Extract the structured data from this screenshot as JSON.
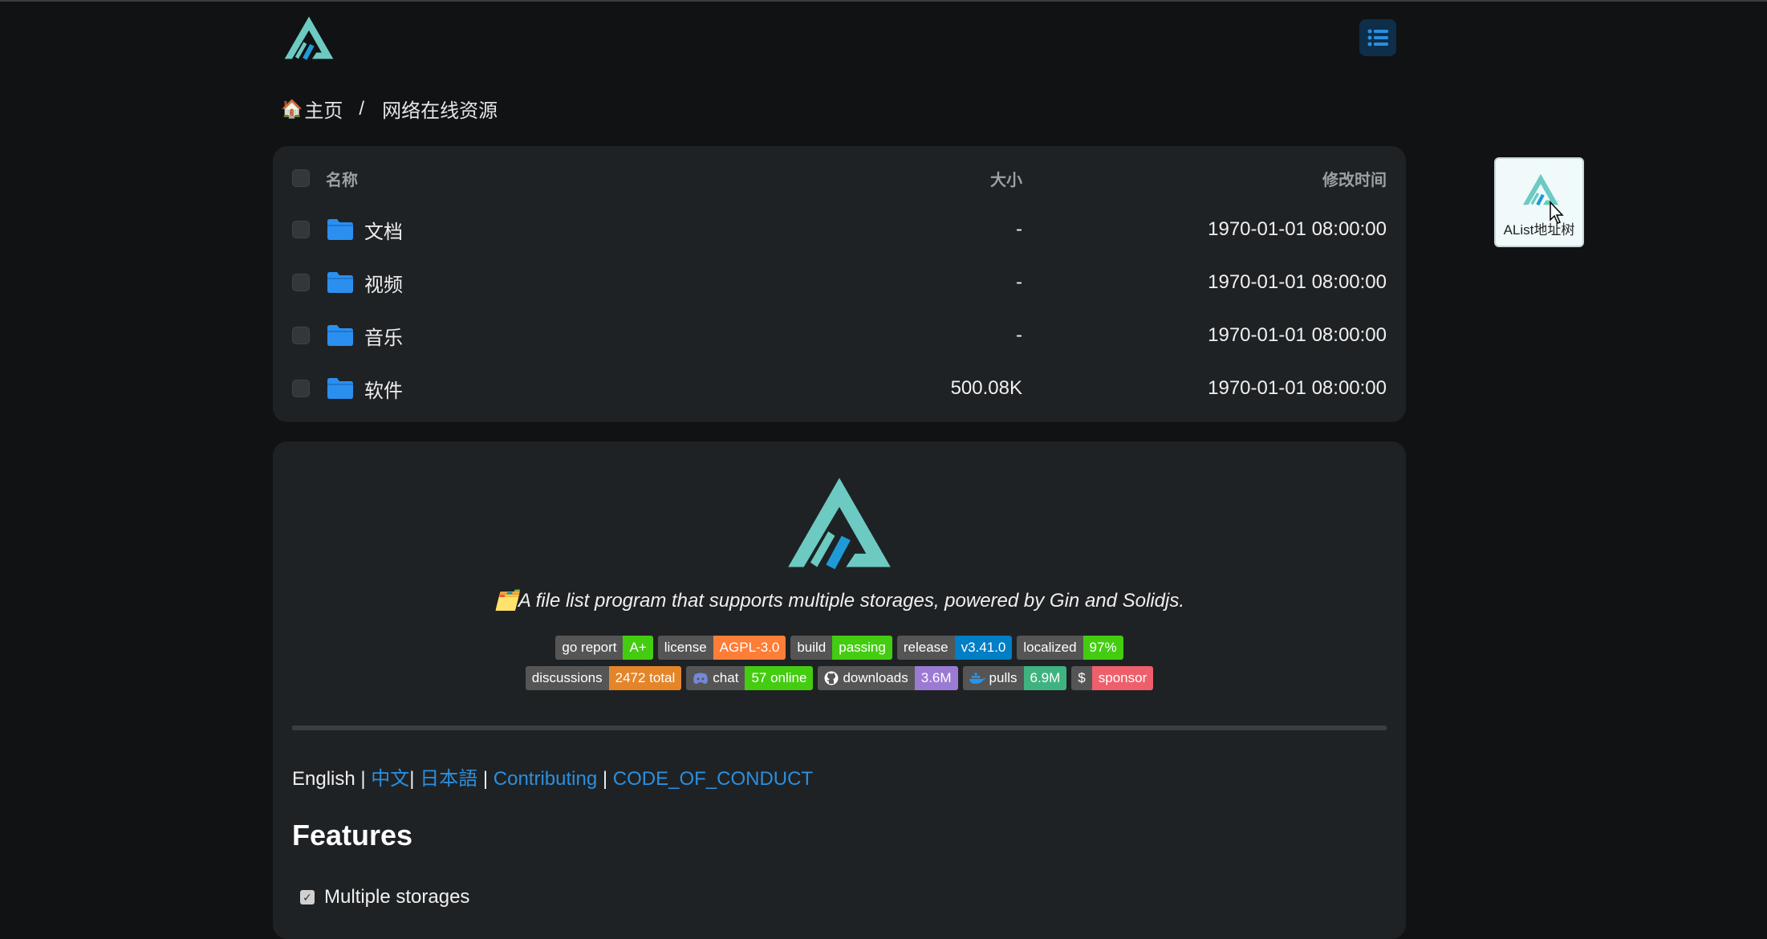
{
  "breadcrumb": {
    "home": "主页",
    "separator": "/",
    "current": "网络在线资源"
  },
  "file_list": {
    "columns": {
      "name": "名称",
      "size": "大小",
      "modified": "修改时间"
    },
    "rows": [
      {
        "name": "文档",
        "size": "-",
        "modified": "1970-01-01 08:00:00",
        "icon": "folder-icon"
      },
      {
        "name": "视频",
        "size": "-",
        "modified": "1970-01-01 08:00:00",
        "icon": "folder-icon"
      },
      {
        "name": "音乐",
        "size": "-",
        "modified": "1970-01-01 08:00:00",
        "icon": "folder-icon"
      },
      {
        "name": "软件",
        "size": "500.08K",
        "modified": "1970-01-01 08:00:00",
        "icon": "folder-icon"
      }
    ]
  },
  "readme": {
    "tagline_emoji": "🗂️",
    "tagline": "A file list program that supports multiple storages, powered by Gin and Solidjs.",
    "badges_row1": [
      {
        "label": "go report",
        "value": "A+",
        "color": "#44cc11"
      },
      {
        "label": "license",
        "value": "AGPL-3.0",
        "color": "#fe7d37"
      },
      {
        "label": "build",
        "value": "passing",
        "color": "#44cc11"
      },
      {
        "label": "release",
        "value": "v3.41.0",
        "color": "#007ec6"
      },
      {
        "label": "localized",
        "value": "97%",
        "color": "#44cc11"
      }
    ],
    "badges_row2": [
      {
        "label": "discussions",
        "value": "2472 total",
        "color": "#e4852a"
      },
      {
        "label": "chat",
        "value": "57 online",
        "color": "#44cc11",
        "icon": "discord-icon"
      },
      {
        "label": "downloads",
        "value": "3.6M",
        "color": "#9b7ad4",
        "icon": "github-icon"
      },
      {
        "label": "pulls",
        "value": "6.9M",
        "color": "#3fb37f",
        "icon": "docker-icon"
      },
      {
        "label": "$",
        "value": "sponsor",
        "color": "#ef5f6b"
      }
    ],
    "languages": {
      "current": "English",
      "sep": "|",
      "links": [
        "中文",
        "日本語",
        "Contributing",
        "CODE_OF_CONDUCT"
      ]
    },
    "features_title": "Features",
    "features": [
      {
        "label": "Multiple storages",
        "checked": true
      }
    ]
  },
  "tree_widget": {
    "label": "AList地址树"
  },
  "colors": {
    "background": "#111214",
    "card": "#1f2224",
    "accent_blue": "#2b8fe0",
    "logo_teal": "#6ccac2",
    "logo_blue": "#1e9bd7"
  }
}
